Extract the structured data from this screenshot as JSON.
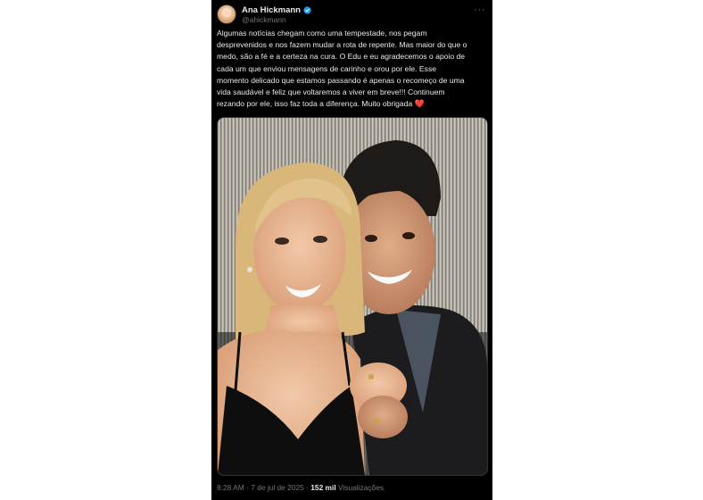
{
  "tweet": {
    "author_name": "Ana Hickmann",
    "handle": "@ahickmann",
    "more_icon": "more-horizontal-icon",
    "verified_icon": "verified-badge-icon",
    "verified_color": "#1d9bf0",
    "text": "Algumas notícias chegam como uma tempestade, nos pegam\ndesprevenidos e nos fazem mudar a rota de repente. Mas maior do que o\nmedo, são a fé e a certeza na cura. O Edu e eu agradecemos o apoio de\ncada um que enviou mensagens de carinho e orou por ele. Esse\nmomento delicado que estamos passando é apenas o recomeço de uma\nvida saudável e feliz que voltaremos a viver em breve!!! Continuem\nrezando por ele, isso faz toda a diferença. Muito obrigada ",
    "heart_emoji": "❤️",
    "time": "8:28 AM",
    "date": "7 de jul de 2025",
    "separator": "·",
    "views_count": "152 mil",
    "views_label": "Visualizações"
  }
}
